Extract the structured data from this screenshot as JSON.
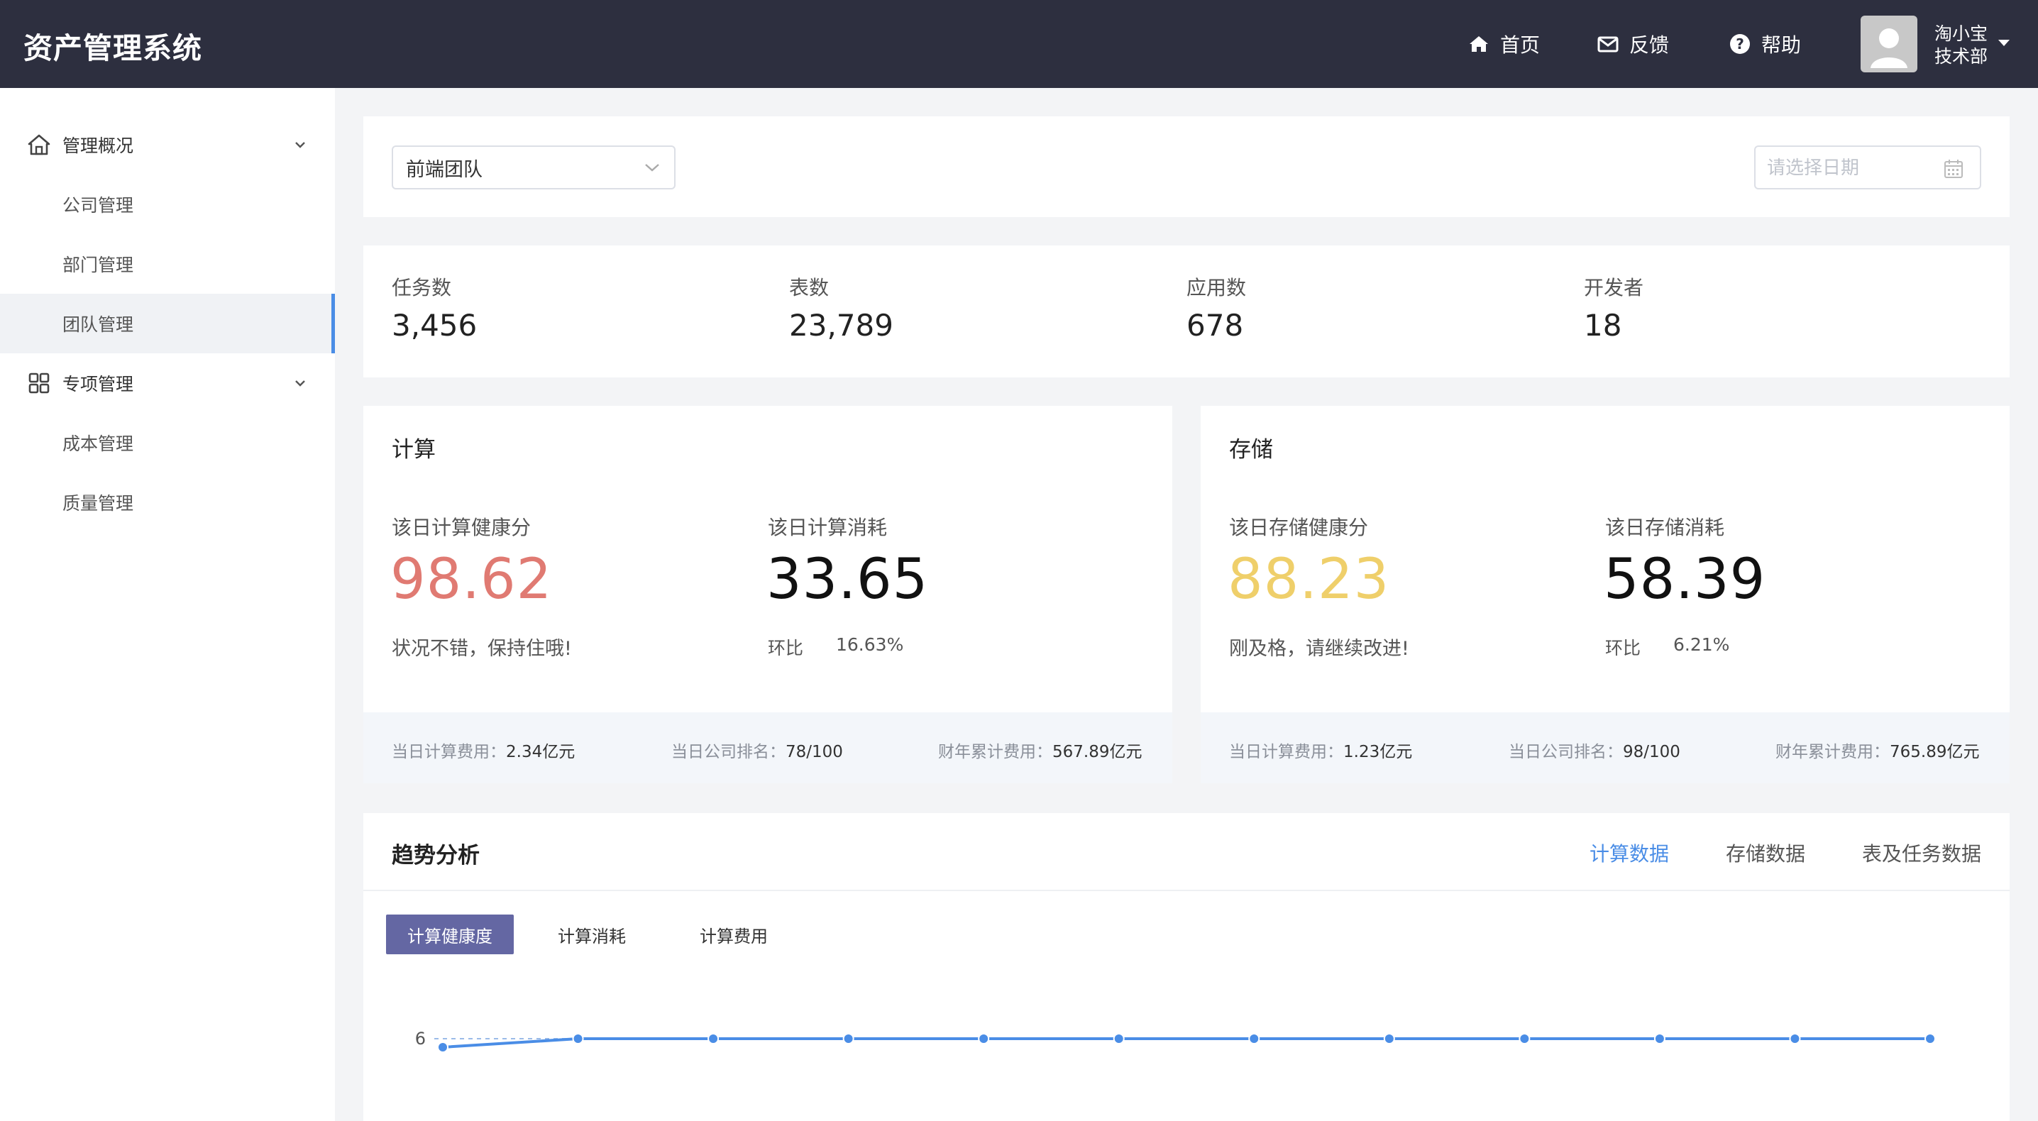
{
  "header": {
    "app_title": "资产管理系统",
    "nav": [
      {
        "label": "首页",
        "icon": "home-icon"
      },
      {
        "label": "反馈",
        "icon": "mail-icon"
      },
      {
        "label": "帮助",
        "icon": "help-icon"
      }
    ],
    "user": {
      "name": "淘小宝",
      "dept": "技术部"
    }
  },
  "sidebar": {
    "groups": [
      {
        "label": "管理概况",
        "icon": "home-icon",
        "items": [
          "公司管理",
          "部门管理",
          "团队管理"
        ]
      },
      {
        "label": "专项管理",
        "icon": "grid-icon",
        "items": [
          "成本管理",
          "质量管理"
        ]
      }
    ],
    "active_item": "团队管理"
  },
  "filters": {
    "team_select": "前端团队",
    "date_placeholder": "请选择日期"
  },
  "stats": [
    {
      "label": "任务数",
      "value": "3,456"
    },
    {
      "label": "表数",
      "value": "23,789"
    },
    {
      "label": "应用数",
      "value": "678"
    },
    {
      "label": "开发者",
      "value": "18"
    }
  ],
  "compute": {
    "title": "计算",
    "health_label": "该日计算健康分",
    "health_value": "98.62",
    "health_color": "#e07a72",
    "health_note": "状况不错，保持住哦!",
    "cost_label": "该日计算消耗",
    "cost_value": "33.65",
    "ratio_label": "环比",
    "ratio_value": "16.63%",
    "footer": [
      {
        "k": "当日计算费用：",
        "v": "2.34亿元"
      },
      {
        "k": "当日公司排名：",
        "v": "78/100"
      },
      {
        "k": "财年累计费用：",
        "v": "567.89亿元"
      }
    ]
  },
  "storage": {
    "title": "存储",
    "health_label": "该日存储健康分",
    "health_value": "88.23",
    "health_color": "#efcf6a",
    "health_note": "刚及格，请继续改进!",
    "cost_label": "该日存储消耗",
    "cost_value": "58.39",
    "ratio_label": "环比",
    "ratio_value": "6.21%",
    "footer": [
      {
        "k": "当日计算费用：",
        "v": "1.23亿元"
      },
      {
        "k": "当日公司排名：",
        "v": "98/100"
      },
      {
        "k": "财年累计费用：",
        "v": "765.89亿元"
      }
    ]
  },
  "trend": {
    "title": "趋势分析",
    "tabs": [
      "计算数据",
      "存储数据",
      "表及任务数据"
    ],
    "active_tab": "计算数据",
    "sub_tabs": [
      "计算健康度",
      "计算消耗",
      "计算费用"
    ],
    "active_sub_tab": "计算健康度"
  },
  "chart_data": {
    "type": "line",
    "series": [
      {
        "values": [
          5.9,
          6,
          6,
          6,
          6,
          6,
          6,
          6,
          6,
          6,
          6,
          6
        ]
      }
    ],
    "y_ticks": [
      "6"
    ],
    "line_color": "#4a8de6"
  }
}
